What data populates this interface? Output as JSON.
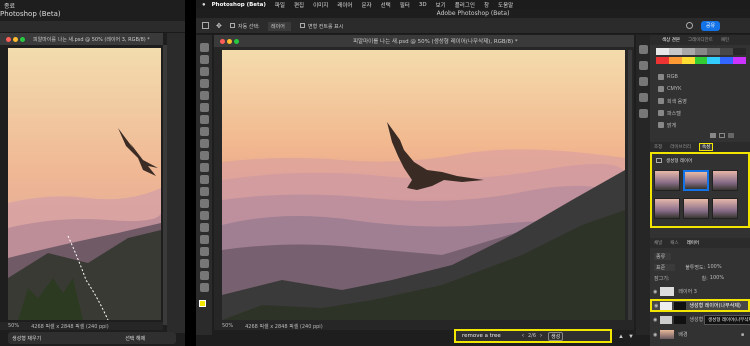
{
  "left_window": {
    "menubar_item": "종료",
    "app_title": "Photoshop (Beta)",
    "doc_tab": "피알마이를 나는 새.psd @ 50% (레이어 3, RGB/8) *",
    "status_zoom": "50%",
    "status_text": "4268 픽셀 x 2848 픽셀 (240 ppi)",
    "bottom_button1": "생성형 채우기",
    "bottom_button2": "선택 해제"
  },
  "right_window": {
    "menu": [
      "Photoshop (Beta)",
      "파일",
      "편집",
      "이미지",
      "레이어",
      "문자",
      "선택",
      "필터",
      "3D",
      "보기",
      "플러그인",
      "창",
      "도움말"
    ],
    "app_title": "Adobe Photoshop (Beta)",
    "share_button": "공유",
    "options": {
      "auto_select": "자동 선택:",
      "auto_select_value": "레이어",
      "transform_controls": "변형 컨트롤 표시"
    },
    "doc_tab": "피알마이를 나는 새.psd @ 50% (생성형 레이어(나무삭제), RGB/8) *",
    "status_zoom": "50%",
    "status_text": "4268 픽셀 x 2848 픽셀 (240 ppi)",
    "taskbar": {
      "prompt": "remove a tree",
      "page": "2/6",
      "generate": "생성"
    }
  },
  "panels": {
    "top_tabs": [
      "색상 견본",
      "그레이디언트",
      "패턴"
    ],
    "swatch_groups": [
      "RGB",
      "CMYK",
      "회색 음영",
      "파스텔",
      "밝게"
    ],
    "swatch_colors": [
      "#e8e8e8",
      "#c8c8c8",
      "#a8a8a8",
      "#888888",
      "#686868",
      "#484848",
      "#282828",
      "#e33",
      "#f93",
      "#fd3",
      "#3c3",
      "#3cf",
      "#36f",
      "#c3f"
    ],
    "prop_tabs": [
      "조정",
      "라이브러리",
      "속성"
    ],
    "prop_title": "생성형 레이어",
    "layers_tabs": [
      "채널",
      "패스",
      "레이어"
    ],
    "filter_label": "종류",
    "blend_mode": "표준",
    "opacity_label": "불투명도:",
    "opacity_value": "100%",
    "fill_label": "칠:",
    "fill_value": "100%",
    "lock_label": "잠그기:",
    "layers": [
      "레이어 3",
      "생성형 레이어(나무삭제)",
      "생성형 레이어(나무삭제)",
      "배경"
    ],
    "tooltip": "생성형 레이어(나무삭제)"
  },
  "colors": {
    "accent_yellow": "#f2e600",
    "ps_blue": "#1473e6",
    "panel_bg": "#323232",
    "chrome_bg": "#2b2b2b"
  }
}
